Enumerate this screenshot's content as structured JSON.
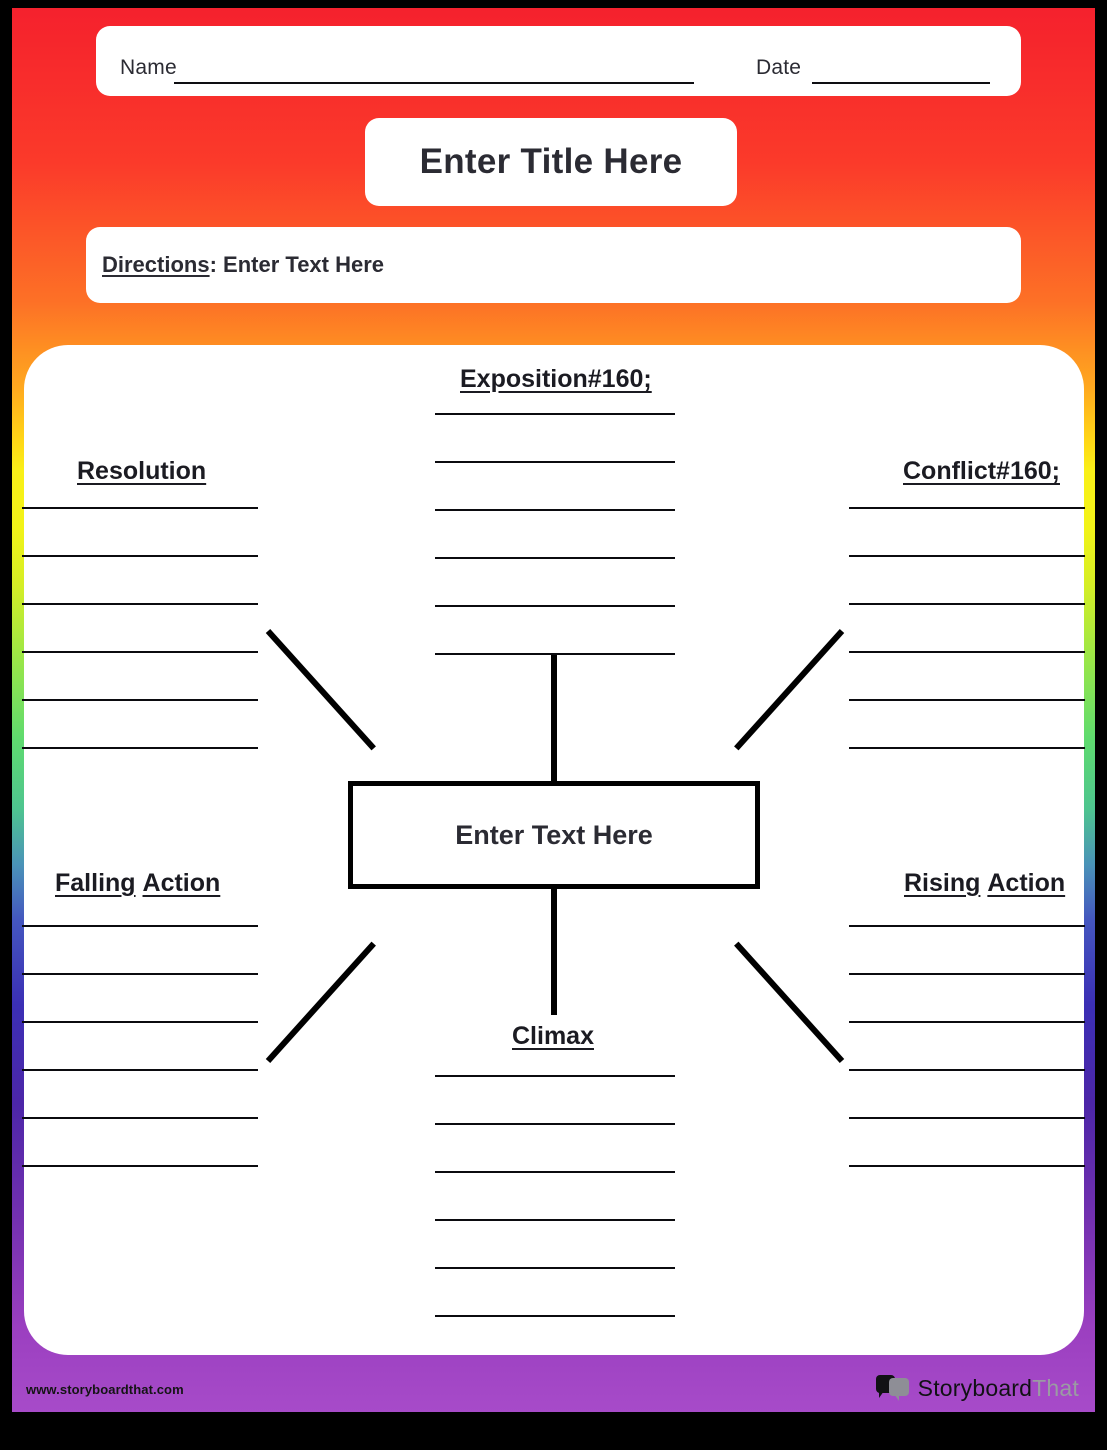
{
  "header": {
    "name_label": "Name",
    "date_label": "Date",
    "title": "Enter Title Here",
    "directions_label": "Directions",
    "directions_colon": ":",
    "directions_value": "Enter Text Here"
  },
  "center": {
    "text": "Enter Text Here"
  },
  "sections": {
    "exposition": {
      "label": "Exposition#160;",
      "lines": 6
    },
    "conflict": {
      "label": "Conflict#160;",
      "lines": 6
    },
    "rising": {
      "label": "Rising Action",
      "lines": 6
    },
    "climax": {
      "label": "Climax",
      "lines": 6
    },
    "falling": {
      "label": "Falling Action",
      "lines": 6
    },
    "resolution": {
      "label": "Resolution",
      "lines": 6
    }
  },
  "falling_parts": {
    "word1": "Falling",
    "word2": "Action"
  },
  "rising_parts": {
    "word1": "Rising",
    "word2": "Action"
  },
  "footer": {
    "url": "www.storyboardthat.com",
    "brand_a": "Storyboard",
    "brand_b": "That"
  },
  "colors": {
    "gradient_top": "#f5212d",
    "gradient_mid": "#f2f318",
    "gradient_green": "#5fdb6e",
    "gradient_blue": "#3b2fb5",
    "gradient_bottom": "#a74bc9",
    "ink": "#000000",
    "paper": "#ffffff"
  }
}
